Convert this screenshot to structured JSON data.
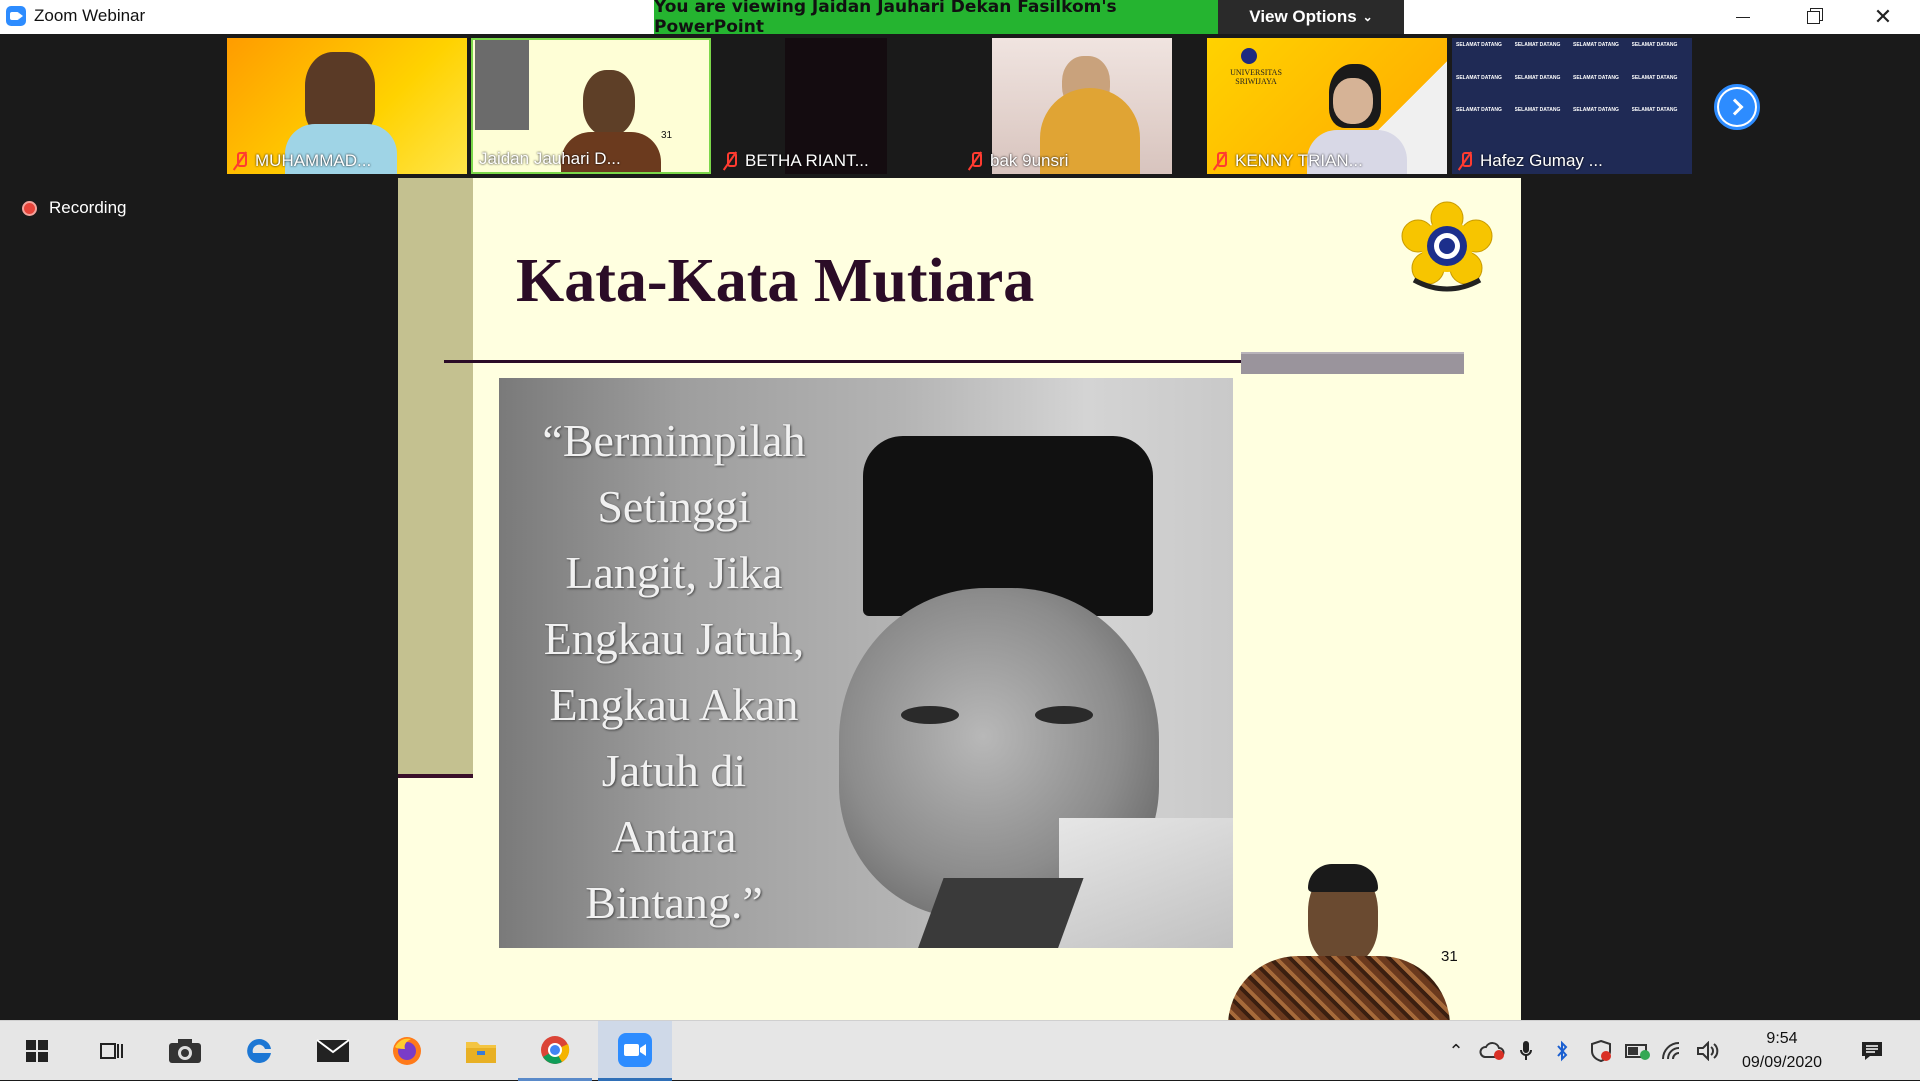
{
  "window": {
    "title": "Zoom Webinar",
    "viewing_banner": "You are viewing Jaidan Jauhari Dekan Fasilkom's PowerPoint",
    "view_options_label": "View Options"
  },
  "participants": [
    {
      "name": "MUHAMMAD...",
      "muted": true
    },
    {
      "name": "Jaidan Jauhari D...",
      "muted": false,
      "badge": "31"
    },
    {
      "name": "BETHA RIANT...",
      "muted": true
    },
    {
      "name": "bak 9unsri",
      "muted": true
    },
    {
      "name": "KENNY TRIAN...",
      "muted": true
    },
    {
      "name": "Hafez Gumay ...",
      "muted": true
    }
  ],
  "tile_text": {
    "unsri_line1": "UNIVERSITAS",
    "unsri_line2": "SRIWIJAYA",
    "welcome": "SELAMAT DATANG"
  },
  "recording_label": "Recording",
  "slide": {
    "title": "Kata-Kata Mutiara",
    "quote_lines": [
      "“Bermimpilah",
      "Setinggi",
      "Langit, Jika",
      "Engkau Jatuh,",
      "Engkau Akan",
      "Jatuh di",
      "Antara",
      "Bintang.”"
    ],
    "logo_text": "UNIVERSITAS SRIWIJAYA",
    "number": "31"
  },
  "taskbar": {
    "time": "9:54",
    "date": "09/09/2020"
  },
  "colors": {
    "zoom_blue": "#2d8cff",
    "banner_green": "#25b430",
    "slide_bg": "#ffffe0",
    "title_color": "#2b0c27",
    "muted_red": "#ff3b30"
  }
}
